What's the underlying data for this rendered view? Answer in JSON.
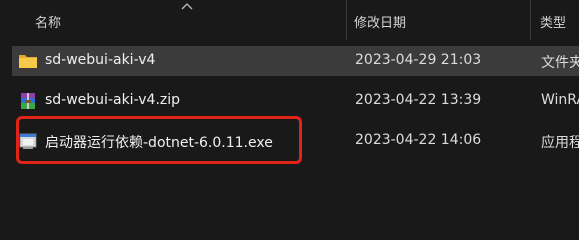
{
  "columns": {
    "name": "名称",
    "modified": "修改日期",
    "type": "类型"
  },
  "files": [
    {
      "name": "sd-webui-aki-v4",
      "modified": "2023-04-29 21:03",
      "type": "文件夹",
      "icon": "folder-icon",
      "selected": true
    },
    {
      "name": "sd-webui-aki-v4.zip",
      "modified": "2023-04-22 13:39",
      "type": "WinRAR",
      "icon": "archive-icon",
      "selected": false
    },
    {
      "name": "启动器运行依赖-dotnet-6.0.11.exe",
      "modified": "2023-04-22 14:06",
      "type": "应用程序",
      "icon": "installer-icon",
      "selected": false
    }
  ],
  "colors": {
    "background": "#191919",
    "selected_row": "#3b3b3b",
    "highlight_border": "#e2231a",
    "folder": "#f7c948"
  }
}
